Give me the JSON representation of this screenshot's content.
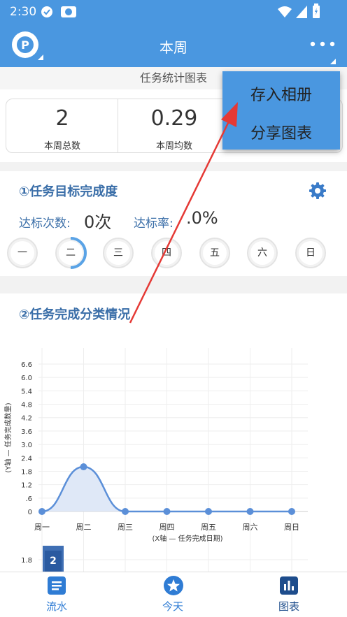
{
  "status_bar": {
    "time": "2:30"
  },
  "app_bar": {
    "title": "本周",
    "more_icon": "more-horizontal-icon"
  },
  "sub_title": "任务统计图表",
  "stats": [
    {
      "value": "2",
      "label": "本周总数"
    },
    {
      "value": "0.29",
      "label": "本周均数"
    }
  ],
  "section1": {
    "title": "①任务目标完成度",
    "hit_label": "达标次数:",
    "hit_value": "0次",
    "rate_label": "达标率:",
    "rate_value": ".0%",
    "days": [
      "一",
      "二",
      "三",
      "四",
      "五",
      "六",
      "日"
    ]
  },
  "section2": {
    "title": "②任务完成分类情况"
  },
  "menu": {
    "items": [
      "存入相册",
      "分享图表"
    ]
  },
  "chart_data": {
    "type": "area",
    "categories": [
      "周一",
      "周二",
      "周三",
      "周四",
      "周五",
      "周六",
      "周日"
    ],
    "values": [
      0,
      2,
      0,
      0,
      0,
      0,
      0
    ],
    "ylim": [
      0,
      6.6
    ],
    "yticks": [
      "6.6",
      "6.0",
      "5.4",
      "4.8",
      "4.2",
      "3.6",
      "3.0",
      "2.4",
      "1.8",
      "1.2",
      ".6",
      "0"
    ],
    "xlabel": "(X轴 — 任务完成日期)",
    "ylabel": "(Y轴 — 任务完成数量)",
    "series_color": "#5b8fd8",
    "fill_color": "#dfe8f7"
  },
  "chart2": {
    "ytick": "1.8",
    "bar_label": "2"
  },
  "bottom_nav": [
    {
      "label": "流水",
      "icon": "list-icon"
    },
    {
      "label": "今天",
      "icon": "star-icon"
    },
    {
      "label": "图表",
      "icon": "bar-chart-icon"
    }
  ],
  "colors": {
    "primary": "#4a97e0",
    "title_blue": "#3a6ea8",
    "arrow_red": "#e53935"
  }
}
